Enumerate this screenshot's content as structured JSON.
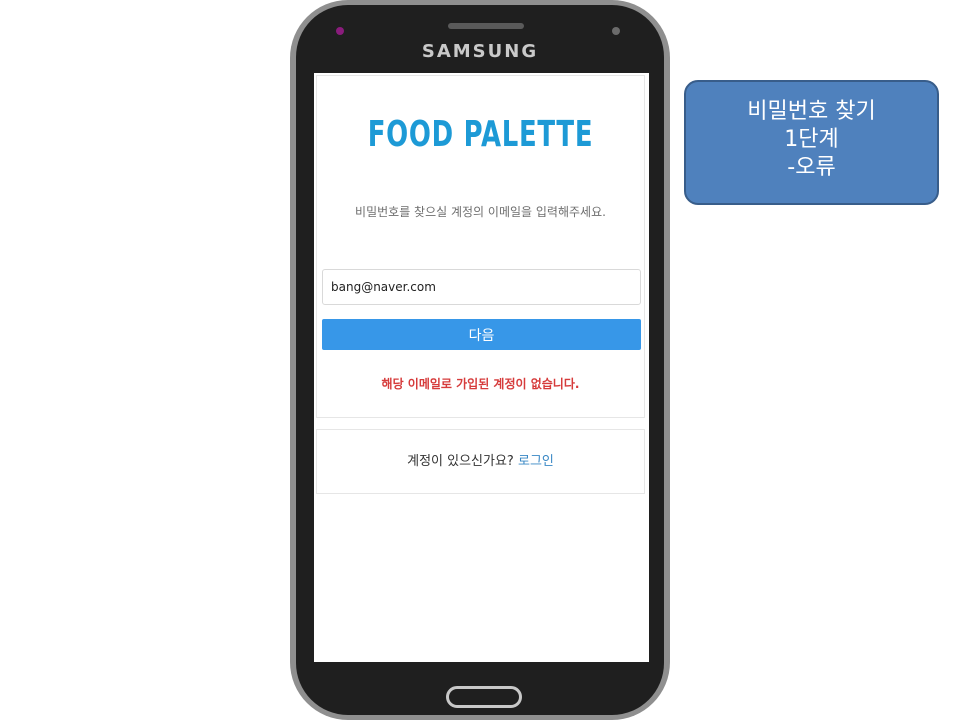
{
  "device": {
    "brand": "SAMSUNG",
    "camera_color": "#8a1c7c"
  },
  "app": {
    "logo_text": "FOOD PALETTE",
    "logo_color": "#1d9ad6",
    "instruction": "비밀번호를 찾으실 계정의 이메일을 입력해주세요.",
    "email_value": "bang@naver.com",
    "next_button_label": "다음",
    "next_button_color": "#3797e8",
    "error_message": "해당 이메일로 가입된 계정이 없습니다.",
    "error_color": "#d63b3b",
    "login_prompt": "계정이 있으신가요?",
    "login_link_label": "로그인",
    "login_link_color": "#3a88c5"
  },
  "annotation": {
    "line1": "비밀번호 찾기",
    "line2": "1단계",
    "line3": "-오류",
    "background_color": "#4f81bd"
  }
}
